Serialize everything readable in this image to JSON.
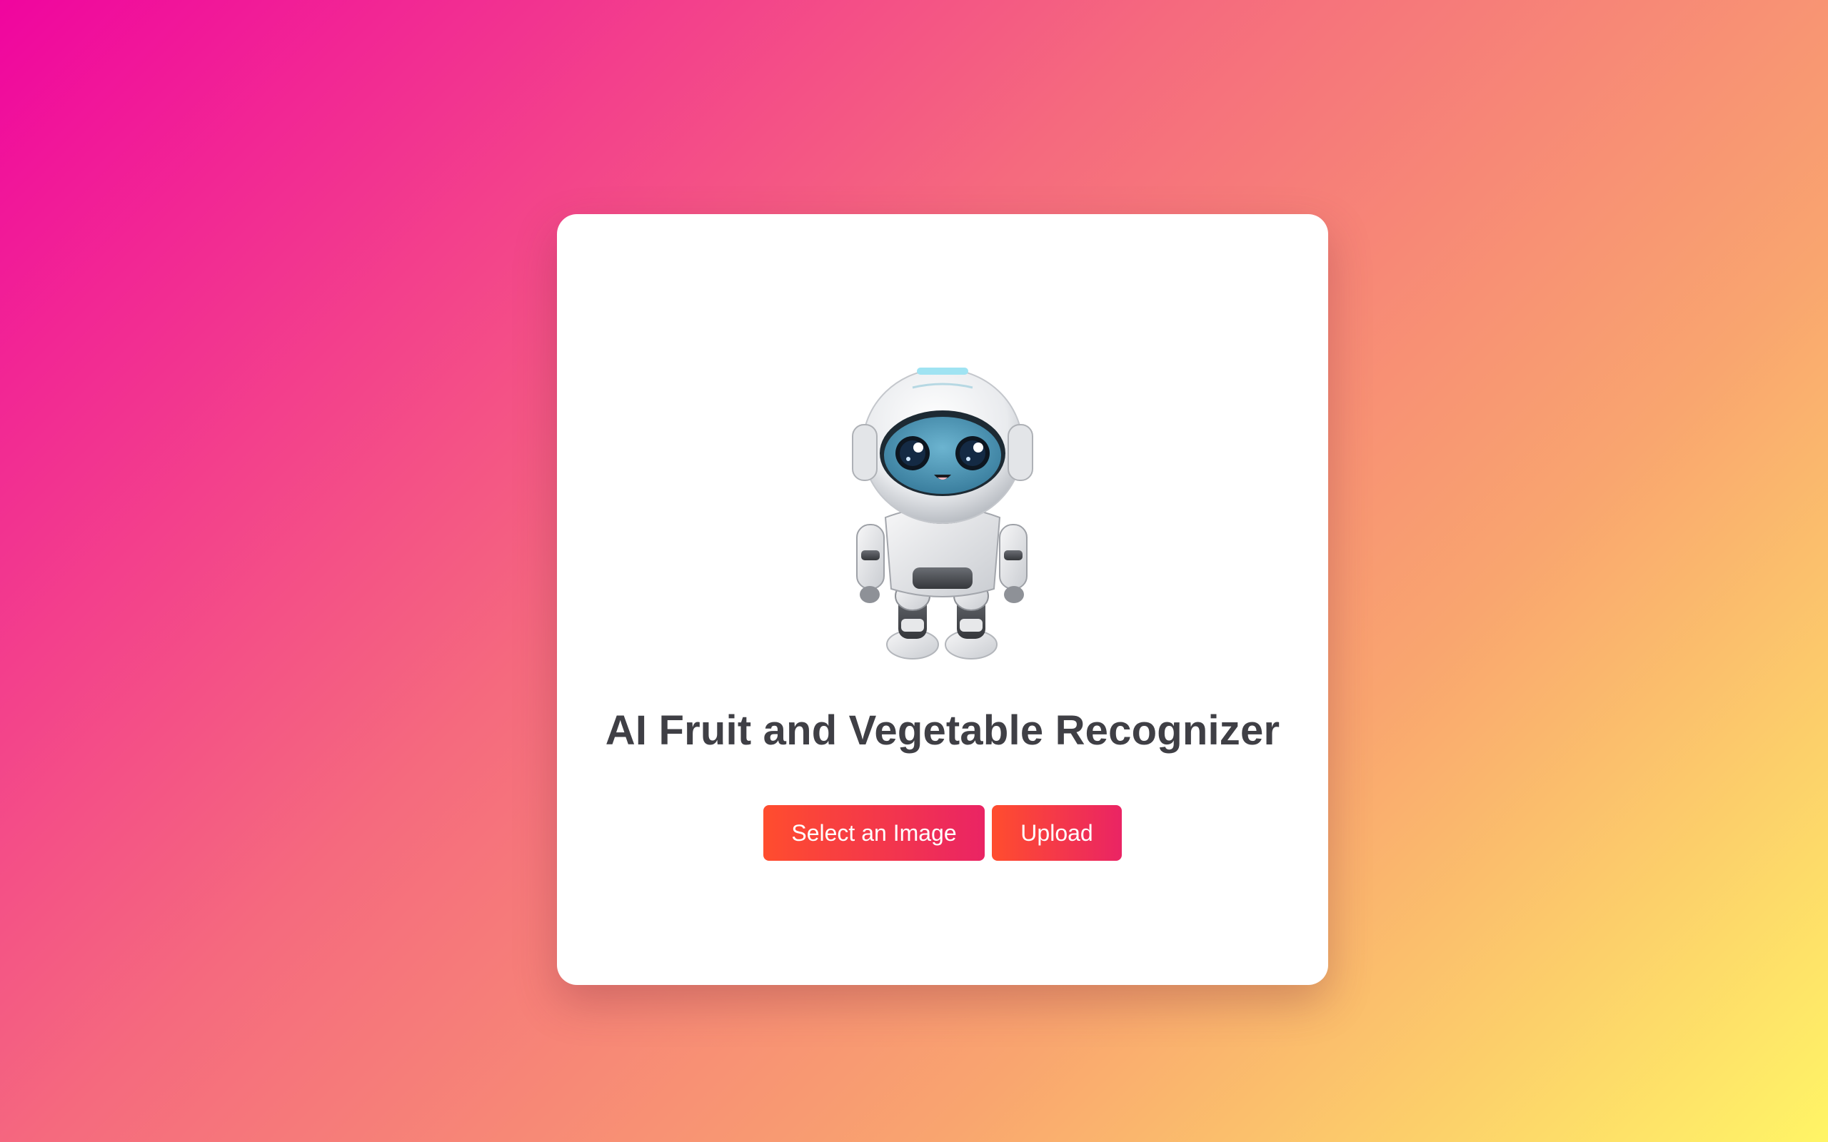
{
  "page": {
    "title": "AI Fruit and Vegetable Recognizer"
  },
  "actions": {
    "select_label": "Select an Image",
    "upload_label": "Upload"
  },
  "hero": {
    "icon": "robot-mascot-icon"
  },
  "colors": {
    "background_start": "#f0059f",
    "background_end": "#fff566",
    "button_start": "#ff4d2e",
    "button_end": "#ea2464",
    "title": "#3f3f45",
    "card": "#ffffff"
  }
}
